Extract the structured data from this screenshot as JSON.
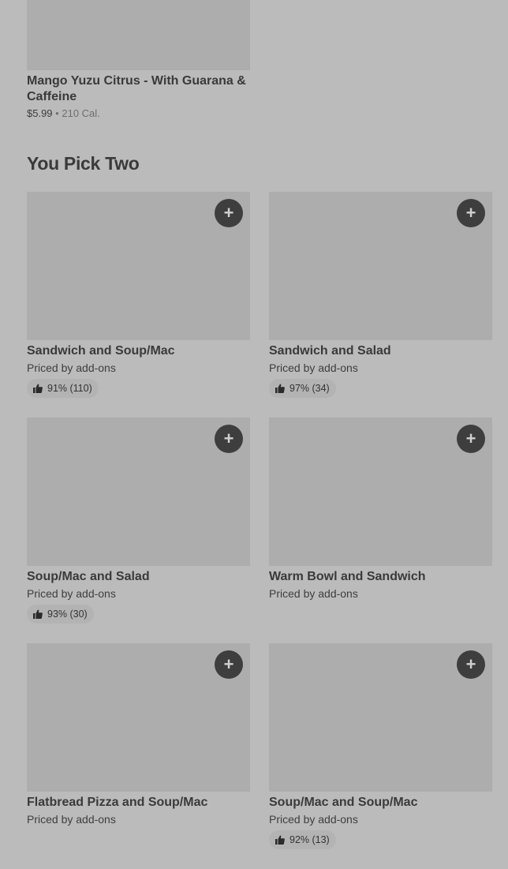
{
  "top_item": {
    "name": "Mango Yuzu Citrus - With Guarana & Caffeine",
    "price": "$5.99",
    "separator": "•",
    "calories": "210 Cal."
  },
  "section": {
    "title": "You Pick Two"
  },
  "add_symbol": "+",
  "items": [
    {
      "name": "Sandwich and Soup/Mac",
      "price": "Priced by add-ons",
      "rating": "91% (110)"
    },
    {
      "name": "Sandwich and Salad",
      "price": "Priced by add-ons",
      "rating": "97% (34)"
    },
    {
      "name": "Soup/Mac and Salad",
      "price": "Priced by add-ons",
      "rating": "93% (30)"
    },
    {
      "name": "Warm Bowl and Sandwich",
      "price": "Priced by add-ons",
      "rating": null
    },
    {
      "name": "Flatbread Pizza and Soup/Mac",
      "price": "Priced by add-ons",
      "rating": null
    },
    {
      "name": "Soup/Mac and Soup/Mac",
      "price": "Priced by add-ons",
      "rating": "92% (13)"
    }
  ]
}
